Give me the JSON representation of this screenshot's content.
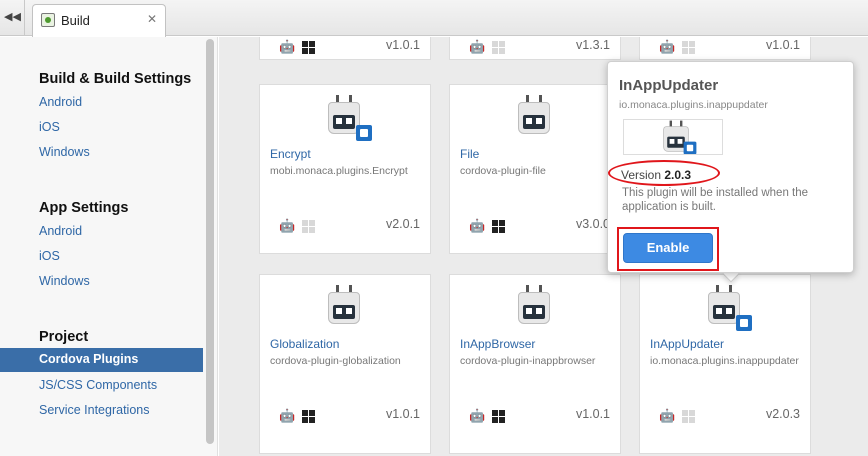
{
  "tab": {
    "label": "Build",
    "close": "✕",
    "back": "◀◀"
  },
  "sidebar": {
    "build": {
      "title": "Build & Build Settings",
      "items": [
        "Android",
        "iOS",
        "Windows"
      ]
    },
    "app": {
      "title": "App Settings",
      "items": [
        "Android",
        "iOS",
        "Windows"
      ]
    },
    "project": {
      "title": "Project",
      "active": "Cordova Plugins",
      "items": [
        "JS/CSS Components",
        "Service Integrations"
      ]
    }
  },
  "top_versions": [
    "v1.0.1",
    "v1.3.1",
    "v1.0.1"
  ],
  "cards": [
    {
      "name": "Encrypt",
      "id": "mobi.monaca.plugins.Encrypt",
      "version": "v2.0.1",
      "windows_enabled": false
    },
    {
      "name": "File",
      "id": "cordova-plugin-file",
      "version": "v3.0.0",
      "windows_enabled": true
    },
    {
      "name": "Globalization",
      "id": "cordova-plugin-globalization",
      "version": "v1.0.1",
      "windows_enabled": true
    },
    {
      "name": "InAppBrowser",
      "id": "cordova-plugin-inappbrowser",
      "version": "v1.0.1",
      "windows_enabled": true
    },
    {
      "name": "InAppUpdater",
      "id": "io.monaca.plugins.inappupdater",
      "version": "v2.0.3",
      "windows_enabled": false
    }
  ],
  "popover": {
    "title": "InAppUpdater",
    "id": "io.monaca.plugins.inappupdater",
    "version_label": "Version",
    "version": "2.0.3",
    "description": "This plugin will be installed when the application is built.",
    "button": "Enable"
  },
  "icons": {
    "apple": "apple-icon",
    "android": "android-icon",
    "windows": "windows-icon"
  },
  "colors": {
    "accent": "#3a6ea8",
    "link": "#2f67a6",
    "enable": "#3d8ae3",
    "highlight": "#e0161b"
  }
}
